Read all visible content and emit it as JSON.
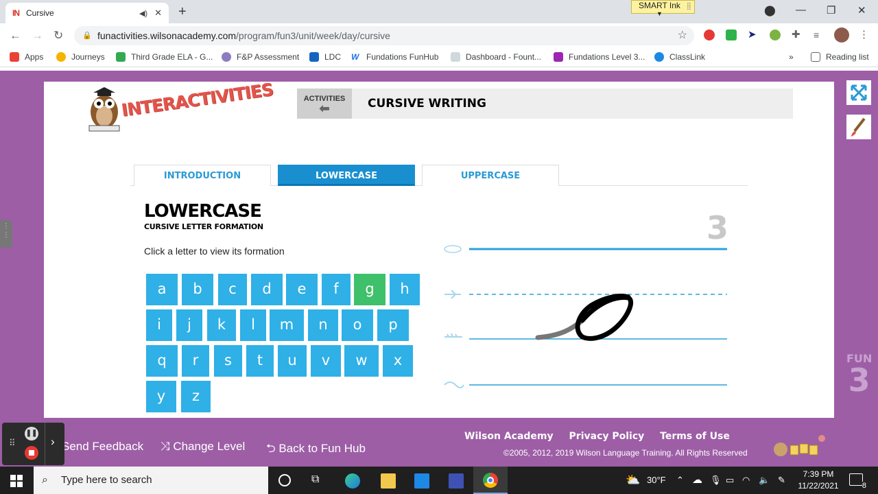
{
  "browser": {
    "tab_title": "Cursive",
    "tab_favicon": "IN",
    "new_tab": "+",
    "smart_ink": "SMART Ink",
    "url_host": "funactivities.wilsonacademy.com",
    "url_path": "/program/fun3/unit/week/day/cursive",
    "bookmarks": [
      "Apps",
      "Journeys",
      "Third Grade ELA - G...",
      "F&P Assessment",
      "LDC",
      "Fundations FunHub",
      "Dashboard - Fount...",
      "Fundations Level 3...",
      "ClassLink"
    ],
    "bookmarks_more": "»",
    "reading_list": "Reading list"
  },
  "header": {
    "logo_text": "INTERACTIVITIES",
    "activities_label": "ACTIVITIES",
    "title": "CURSIVE WRITING"
  },
  "tabs": [
    {
      "label": "INTRODUCTION",
      "active": false
    },
    {
      "label": "LOWERCASE",
      "active": true
    },
    {
      "label": "UPPERCASE",
      "active": false
    }
  ],
  "section": {
    "heading": "LOWERCASE",
    "subheading": "CURSIVE LETTER FORMATION",
    "instruction": "Click a letter to view its formation",
    "selected_letter": "g",
    "level_number": "3"
  },
  "letters": [
    [
      "a",
      "b",
      "c",
      "d",
      "e",
      "f",
      "g",
      "h"
    ],
    [
      "i",
      "j",
      "k",
      "l",
      "m",
      "n",
      "o",
      "p"
    ],
    [
      "q",
      "r",
      "s",
      "t",
      "u",
      "v",
      "w",
      "x"
    ],
    [
      "y",
      "z"
    ]
  ],
  "footer": {
    "links": [
      "Wilson Academy",
      "Privacy Policy",
      "Terms of Use"
    ],
    "copyright": "©2005, 2012, 2019 Wilson Language Training. All Rights Reserved",
    "send_feedback": "Send Feedback",
    "change_level": "Change Level",
    "back_to_hub": "Back to Fun Hub",
    "fun_badge": "FUN",
    "fun_level": "3"
  },
  "taskbar": {
    "search_placeholder": "Type here to search",
    "weather": "30°F",
    "time": "7:39 PM",
    "date": "11/22/2021",
    "notifications": "8"
  },
  "colors": {
    "page_bg": "#9d5ea6",
    "key_blue": "#2fb0e6",
    "key_selected": "#3fc06a",
    "tab_active": "#1a8fd0"
  }
}
